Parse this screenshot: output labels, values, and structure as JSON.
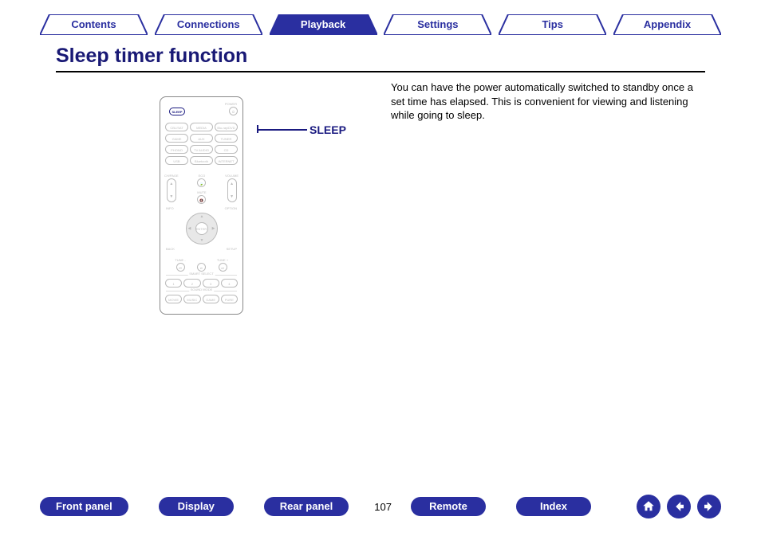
{
  "tabs": {
    "contents": "Contents",
    "connections": "Connections",
    "playback": "Playback",
    "settings": "Settings",
    "tips": "Tips",
    "appendix": "Appendix"
  },
  "title": "Sleep timer function",
  "body_text": "You can have the power automatically switched to standby once a set time has elapsed. This is convenient for viewing and listening while going to sleep.",
  "callout": "SLEEP",
  "remote": {
    "power": "POWER",
    "sleep": "SLEEP",
    "row1": [
      "CBL/SAT",
      "MEDIA PLAYER",
      "Blu-ray/DVD"
    ],
    "row2": [
      "GAME",
      "AUX",
      "TUNER"
    ],
    "row3": [
      "PHONO",
      "TV AUDIO",
      "CD"
    ],
    "row4": [
      "USB",
      "Bluetooth",
      "INTERNET RADIO"
    ],
    "eco": "ECO",
    "ch": "CH/PAGE",
    "mute": "MUTE",
    "vol": "VOLUME",
    "info": "INFO",
    "option": "OPTION",
    "enter": "ENTER",
    "back": "BACK",
    "setup": "SETUP",
    "tune_minus": "TUNE -",
    "tune_plus": "TUNE +",
    "smart": "SMART SELECT",
    "s1": "1",
    "s2": "2",
    "s3": "3",
    "s4": "4",
    "sound": "SOUND MODE",
    "m1": "MOVIE",
    "m2": "MUSIC",
    "m3": "GAME",
    "m4": "PURE"
  },
  "bottom": {
    "front": "Front panel",
    "display": "Display",
    "rear": "Rear panel",
    "remote": "Remote",
    "index": "Index"
  },
  "page": "107"
}
